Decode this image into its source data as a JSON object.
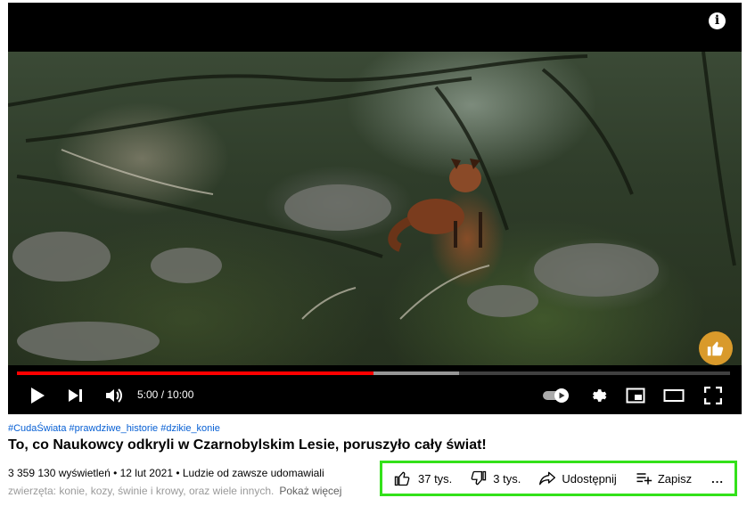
{
  "player": {
    "info_label": "i",
    "time_display": "5:00 / 10:00",
    "progress_fraction": 0.5,
    "buffer_fraction": 0.62,
    "accent_color": "#ff0000"
  },
  "video": {
    "hashtags": "#CudaŚwiata #prawdziwe_historie #dzikie_konie",
    "title": "To, co Naukowcy odkryli w Czarnobylskim Lesie, poruszyło cały świat!",
    "meta_line1": "3 359 130 wyświetleń • 12 lut 2021 • Ludzie od zawsze udomawiali",
    "meta_line2": "zwierzęta: konie, kozy, świnie i krowy, oraz wiele innych.",
    "show_more": "Pokaż więcej"
  },
  "actions": {
    "like_count": "37 tys.",
    "dislike_count": "3 tys.",
    "share_label": "Udostępnij",
    "save_label": "Zapisz",
    "more_label": "...",
    "highlight_color": "#33e11a"
  }
}
